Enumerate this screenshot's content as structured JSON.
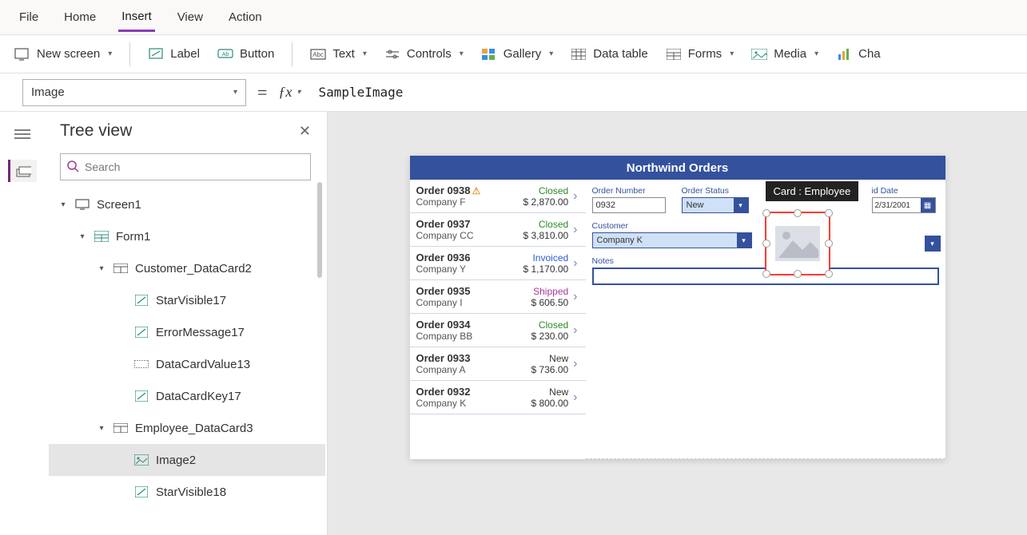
{
  "top_menu": {
    "file": "File",
    "home": "Home",
    "insert": "Insert",
    "view": "View",
    "action": "Action"
  },
  "ribbon": {
    "new_screen": "New screen",
    "label": "Label",
    "button": "Button",
    "text": "Text",
    "controls": "Controls",
    "gallery": "Gallery",
    "data_table": "Data table",
    "forms": "Forms",
    "media": "Media",
    "charts": "Cha"
  },
  "formula": {
    "property": "Image",
    "value": "SampleImage"
  },
  "tree": {
    "title": "Tree view",
    "search_placeholder": "Search",
    "items": [
      {
        "label": "Screen1",
        "icon": "screen",
        "depth": 1,
        "exp": "▾"
      },
      {
        "label": "Form1",
        "icon": "form",
        "depth": 2,
        "exp": "▾"
      },
      {
        "label": "Customer_DataCard2",
        "icon": "card",
        "depth": 3,
        "exp": "▾"
      },
      {
        "label": "StarVisible17",
        "icon": "label",
        "depth": 4
      },
      {
        "label": "ErrorMessage17",
        "icon": "label",
        "depth": 4
      },
      {
        "label": "DataCardValue13",
        "icon": "input",
        "depth": 4
      },
      {
        "label": "DataCardKey17",
        "icon": "label",
        "depth": 4
      },
      {
        "label": "Employee_DataCard3",
        "icon": "card",
        "depth": 3,
        "exp": "▾"
      },
      {
        "label": "Image2",
        "icon": "image",
        "depth": 4,
        "selected": true
      },
      {
        "label": "StarVisible18",
        "icon": "label",
        "depth": 4
      }
    ]
  },
  "app": {
    "title": "Northwind Orders",
    "orders": [
      {
        "id": "Order 0938",
        "co": "Company F",
        "status": "Closed",
        "amt": "$ 2,870.00",
        "warn": true
      },
      {
        "id": "Order 0937",
        "co": "Company CC",
        "status": "Closed",
        "amt": "$ 3,810.00"
      },
      {
        "id": "Order 0936",
        "co": "Company Y",
        "status": "Invoiced",
        "amt": "$ 1,170.00"
      },
      {
        "id": "Order 0935",
        "co": "Company I",
        "status": "Shipped",
        "amt": "$ 606.50"
      },
      {
        "id": "Order 0934",
        "co": "Company BB",
        "status": "Closed",
        "amt": "$ 230.00"
      },
      {
        "id": "Order 0933",
        "co": "Company A",
        "status": "New",
        "amt": "$ 736.00"
      },
      {
        "id": "Order 0932",
        "co": "Company K",
        "status": "New",
        "amt": "$ 800.00"
      }
    ],
    "detail": {
      "order_number_lbl": "Order Number",
      "order_number": "0932",
      "order_status_lbl": "Order Status",
      "order_status": "New",
      "paid_date_lbl": "id Date",
      "paid_date": "2/31/2001",
      "customer_lbl": "Customer",
      "customer": "Company K",
      "notes_lbl": "Notes"
    },
    "tooltip": "Card : Employee"
  }
}
